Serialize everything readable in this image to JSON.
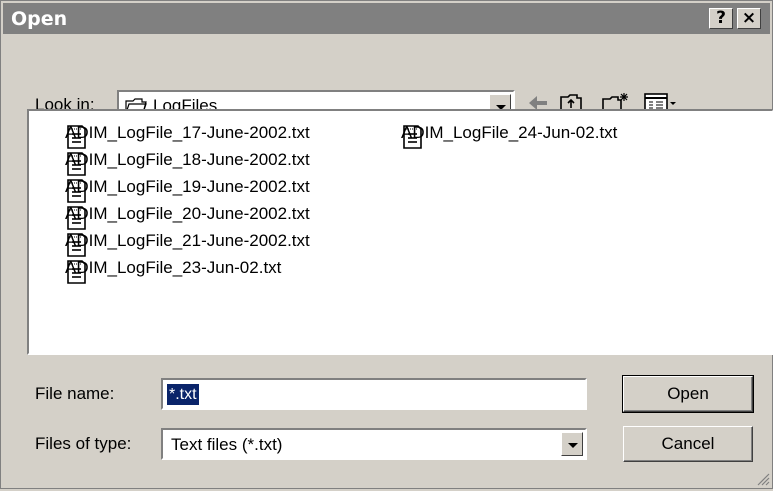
{
  "window": {
    "title": "Open",
    "help_label": "?",
    "close_label": "×"
  },
  "look_in": {
    "label": "Look in:",
    "value": "LogFiles"
  },
  "toolbar": {
    "icons": [
      "back-arrow-icon",
      "up-folder-icon",
      "new-folder-icon",
      "view-menu-icon"
    ]
  },
  "files": [
    "ADIM_LogFile_17-June-2002.txt",
    "ADIM_LogFile_18-June-2002.txt",
    "ADIM_LogFile_19-June-2002.txt",
    "ADIM_LogFile_20-June-2002.txt",
    "ADIM_LogFile_21-June-2002.txt",
    "ADIM_LogFile_23-Jun-02.txt",
    "ADIM_LogFile_24-Jun-02.txt"
  ],
  "file_name": {
    "label": "File name:",
    "value": "*.txt"
  },
  "file_type": {
    "label": "Files of type:",
    "value": "Text files (*.txt)"
  },
  "buttons": {
    "open": "Open",
    "cancel": "Cancel"
  }
}
